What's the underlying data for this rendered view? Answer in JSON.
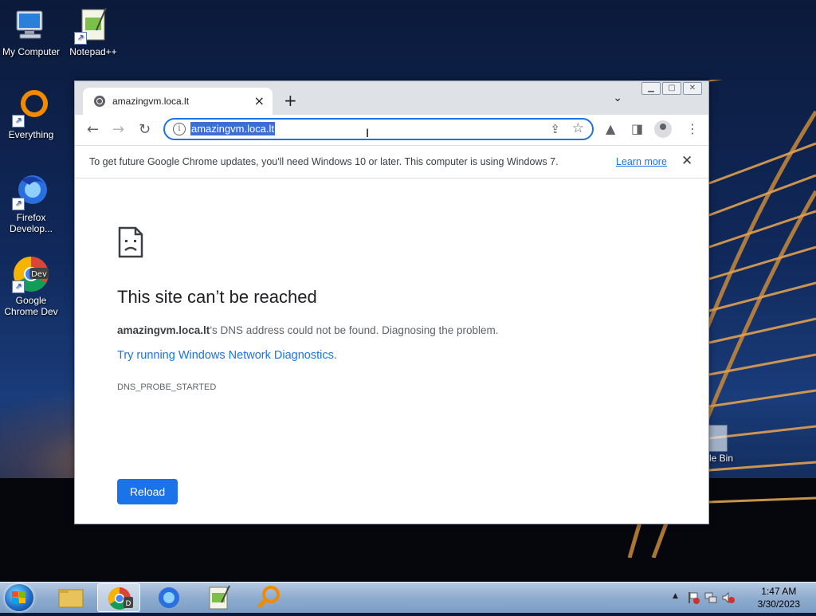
{
  "desktop": {
    "icons": [
      {
        "label": "My Computer",
        "icon": "computer-icon"
      },
      {
        "label": "Notepad++",
        "icon": "notepadpp-icon"
      },
      {
        "label": "Everything",
        "icon": "everything-search-icon"
      },
      {
        "label": "Firefox Develop...",
        "icon": "firefox-dev-icon"
      },
      {
        "label": "Google Chrome Dev",
        "icon": "chrome-dev-icon"
      },
      {
        "label": "cle Bin",
        "icon": "recycle-bin-icon"
      }
    ]
  },
  "browser": {
    "tab": {
      "title": "amazingvm.loca.lt",
      "close": "×"
    },
    "new_tab": "+",
    "tab_menu": "⌄",
    "nav": {
      "back": "←",
      "forward": "→",
      "reload": "↻"
    },
    "omnibox": {
      "url": "amazingvm.loca.lt",
      "info": "i"
    },
    "infobar": {
      "message": "To get future Google Chrome updates, you'll need Windows 10 or later. This computer is using Windows 7.",
      "learn_more": "Learn more",
      "close": "✕"
    },
    "error": {
      "title": "This site can’t be reached",
      "host": "amazingvm.loca.lt",
      "desc_rest": "’s DNS address could not be found. Diagnosing the problem.",
      "link": "Try running Windows Network Diagnostics.",
      "code": "DNS_PROBE_STARTED",
      "reload": "Reload"
    }
  },
  "taskbar": {
    "clock_time": "1:47 AM",
    "clock_date": "3/30/2023",
    "tray_arrow": "▲"
  }
}
